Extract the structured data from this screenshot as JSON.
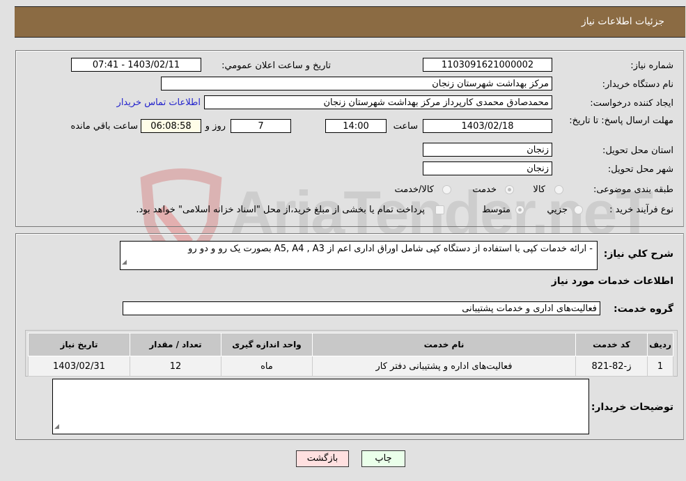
{
  "header": {
    "title": "جزئیات اطلاعات نیاز"
  },
  "fields": {
    "need_number_label": "شماره نیاز:",
    "need_number": "1103091621000002",
    "announce_label": "تاریخ و ساعت اعلان عمومي:",
    "announce_value": "1403/02/11 - 07:41",
    "buyer_org_label": "نام دستگاه خريدار:",
    "buyer_org": "مرکز بهداشت شهرستان زنجان",
    "creator_label": "ایجاد کننده درخواست:",
    "creator": "محمدصادق محمدی کارپرداز مرکز بهداشت شهرستان زنجان",
    "contact_link": "اطلاعات تماس خریدار",
    "deadline_label": "مهلت ارسال پاسخ: تا تاریخ:",
    "deadline_date": "1403/02/18",
    "time_label": "ساعت",
    "deadline_time": "14:00",
    "days_value": "7",
    "days_label": "روز و",
    "remaining_time": "06:08:58",
    "remaining_label": "ساعت باقي مانده",
    "province_label": "استان محل تحویل:",
    "province": "زنجان",
    "city_label": "شهر محل تحویل:",
    "city": "زنجان",
    "category_label": "طبقه بندی موضوعی:",
    "category_options": [
      "کالا",
      "خدمت",
      "کالا/خدمت"
    ],
    "category_selected": "خدمت",
    "process_label": "نوع فرآیند خرید :",
    "process_options": [
      "جزيي",
      "متوسط"
    ],
    "process_selected": "متوسط",
    "treasury_note": "پرداخت تمام یا بخشی از مبلغ خرید،از محل \"اسناد خزانه اسلامی\" خواهد بود."
  },
  "description": {
    "label": "شرح کلي نياز:",
    "text": "-        ارائه خدمات کپی با استفاده از دستگاه کپی شامل اوراق اداری اعم از A5, A4 , A3 بصورت یک رو و دو رو"
  },
  "services": {
    "section_title": "اطلاعات خدمات مورد نیاز",
    "group_label": "گروه خدمت:",
    "group_value": "فعالیت‌های اداری و خدمات پشتیبانی",
    "columns": [
      "ردیف",
      "کد خدمت",
      "نام خدمت",
      "واحد اندازه گیری",
      "تعداد / مقدار",
      "تاریخ نیاز"
    ],
    "rows": [
      {
        "index": "1",
        "code": "ز-82-821",
        "name": "فعالیت‌های اداره و پشتیبانی دفتر کار",
        "unit": "ماه",
        "qty": "12",
        "date": "1403/02/31"
      }
    ]
  },
  "buyer_notes": {
    "label": "توضیحات خریدار:",
    "value": ""
  },
  "buttons": {
    "print": "چاپ",
    "back": "بازگشت"
  },
  "watermark": {
    "text": "AriaTender.neT"
  }
}
